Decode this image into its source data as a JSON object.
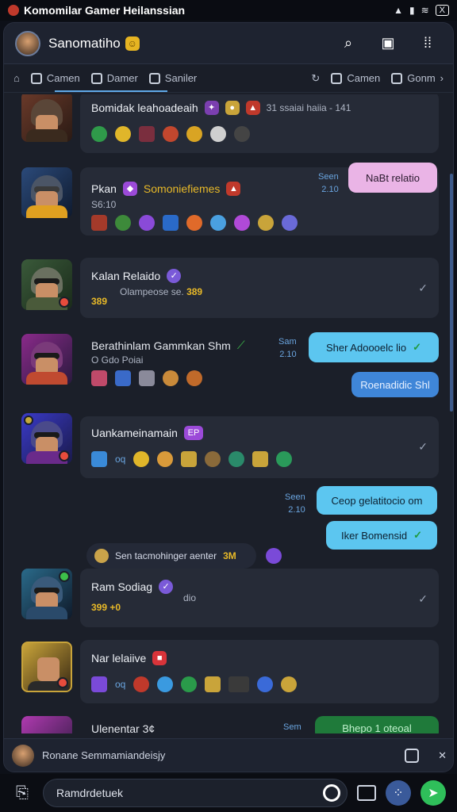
{
  "status_bar": {
    "app_title": "Komomilar Gamer Heilanssian",
    "battery": "X"
  },
  "header": {
    "title": "Sanomatiho"
  },
  "tabs": [
    {
      "label": "Camen"
    },
    {
      "label": "Damer"
    },
    {
      "label": "Saniler"
    }
  ],
  "tabs_more": "Gonm",
  "rows": [
    {
      "title": "Bomidak leahoadeaih",
      "meta": "31 ssaiai haiia - 141"
    },
    {
      "title": "Pkan",
      "tag": "Somoniefiemes",
      "sub": "S6:10",
      "time": "Seen",
      "date": "2.10",
      "bubble": "NaBt relatio"
    },
    {
      "title": "Kalan Relaido",
      "sub": "Olampeose se.",
      "gold": "389",
      "gold2": "389"
    },
    {
      "title": "Berathinlam Gammkan Shm",
      "sub": "O Gdo Poiai",
      "time": "Sam",
      "date": "2.10",
      "bubble": "Sher Adoooelc lio",
      "bubble2": "Roenadidic Shl"
    },
    {
      "title": "Uankameinamain",
      "tag": "EP",
      "emote_text": "oq"
    },
    {
      "time": "Seen",
      "date": "2.10",
      "bubble": "Ceop gelatitocio om",
      "bubble2": "Iker Bomensid",
      "pill": "Sen tacmohinger aenter",
      "pill_gold": "3M"
    },
    {
      "title": "Ram Sodiag",
      "sub": "dio",
      "gold": "399",
      "gold2": "+0"
    },
    {
      "title": "Nar lelaiive",
      "emote_text": "oq"
    },
    {
      "title": "Ulenentar 3¢",
      "time": "Sem",
      "bubble": "Bhepo 1 oteoal"
    }
  ],
  "input_bar": {
    "text": "Ronane Semmamiandeisjy"
  },
  "bottom_bar": {
    "input_text": "Ramdrdetuek"
  }
}
